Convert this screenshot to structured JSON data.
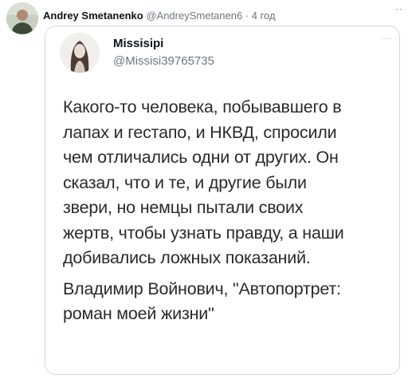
{
  "outer_tweet": {
    "author_name": "Andrey Smetanenko",
    "meta": "@AndreySmetanen6 · 4 год",
    "more_icon": "ellipsis-icon"
  },
  "quoted_tweet": {
    "author_name": "Missisipi",
    "handle": "@Missisi39765735",
    "more_icon": "ellipsis-icon",
    "text_lines": [
      "Какого-то человека, побывавшего в",
      "лапах и гестапо, и НКВД, спросили",
      "чем отличались одни от других. Он",
      "сказал, что и те, и другие были",
      "звери, но немцы пытали своих",
      "жертв, чтобы узнать правду, а наши",
      "добивались ложных показаний."
    ],
    "citation_lines": [
      "Владимир Войнович, \"Автопортрет:",
      "роман моей жизни\""
    ]
  },
  "colors": {
    "border": "#cfd9de",
    "secondary_text": "#6e767d",
    "primary_text": "#0f1419"
  }
}
